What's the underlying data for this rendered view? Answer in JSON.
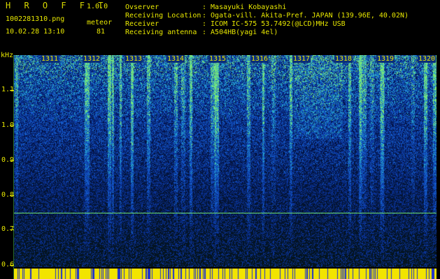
{
  "header": {
    "app_title": "H R O F F T",
    "version": "1.0.0",
    "filename": "1002281310.png",
    "mode_label": "meteor",
    "datetime": "10.02.28 13:10",
    "count": "81"
  },
  "info": {
    "rows": [
      {
        "label": "Ovserver",
        "value": ": Masayuki Kobayashi"
      },
      {
        "label": "Receiving Location",
        "value": ": Ogata-vill. Akita-Pref. JAPAN (139.96E, 40.02N)"
      },
      {
        "label": "Receiver",
        "value": ": ICOM IC-575 53.7492(@LCD)MHz USB"
      },
      {
        "label": "Receiving antenna",
        "value": ": A504HB(yagi 4el)"
      }
    ]
  },
  "y_axis": {
    "unit": "kHz",
    "ticks": [
      "1.1",
      "1.0",
      "0.9",
      "0.8",
      "0.7",
      "0.6"
    ]
  },
  "x_axis": {
    "ticks": [
      "1311",
      "1312",
      "1313",
      "1314",
      "1315",
      "1316",
      "1317",
      "1318",
      "1319",
      "1320"
    ]
  },
  "colors": {
    "text": "#e8e800",
    "spectrum_bg": "#0a2f78",
    "signal": "#6fe06f",
    "bottom_bar": "#f2e400"
  }
}
